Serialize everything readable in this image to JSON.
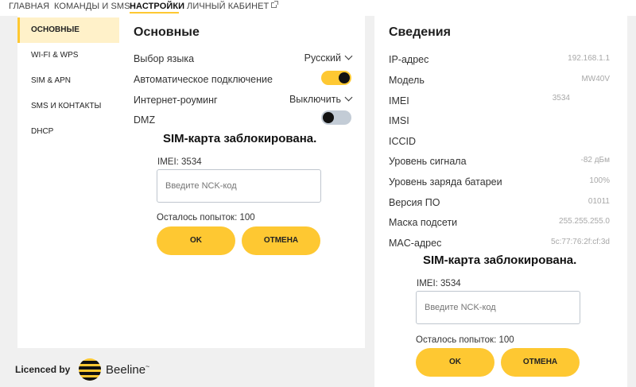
{
  "nav": {
    "items": [
      {
        "label": "ГЛАВНАЯ",
        "active": false
      },
      {
        "label": "КОМАНДЫ И SMS",
        "active": false
      },
      {
        "label": "НАСТРОЙКИ",
        "active": true
      },
      {
        "label": "ЛИЧНЫЙ КАБИНЕТ",
        "active": false,
        "icon": "external-link-icon"
      }
    ]
  },
  "sidebar": {
    "items": [
      {
        "label": "ОСНОВНЫЕ",
        "active": true
      },
      {
        "label": "WI-FI & WPS",
        "active": false
      },
      {
        "label": "SIM & APN",
        "active": false
      },
      {
        "label": "SMS И КОНТАКТЫ",
        "active": false
      },
      {
        "label": "DHCP",
        "active": false
      }
    ]
  },
  "basic": {
    "title": "Основные",
    "language_label": "Выбор языка",
    "language_value": "Русский",
    "autoconnect_label": "Автоматическое подключение",
    "autoconnect_on": true,
    "roaming_label": "Интернет-роуминг",
    "roaming_value": "Выключить",
    "dmz_label": "DMZ",
    "dmz_on": false
  },
  "sim_lock_left": {
    "title": "SIM-карта заблокирована.",
    "imei": "IMEI: 3534",
    "placeholder": "Введите NCK-код",
    "attempts": "Осталось попыток: 100",
    "ok_label": "OK",
    "cancel_label": "ОТМЕНА"
  },
  "info": {
    "title": "Сведения",
    "rows": [
      {
        "label": "IP-адрес",
        "value": "192.168.1.1"
      },
      {
        "label": "Модель",
        "value": "MW40V"
      },
      {
        "label": "IMEI",
        "value": "3534"
      },
      {
        "label": "IMSI",
        "value": ""
      },
      {
        "label": "ICCID",
        "value": ""
      },
      {
        "label": "Уровень сигнала",
        "value": "-82 дБм"
      },
      {
        "label": "Уровень заряда батареи",
        "value": "100%"
      },
      {
        "label": "Версия ПО",
        "value": "01011"
      },
      {
        "label": "Маска подсети",
        "value": "255.255.255.0"
      },
      {
        "label": "MAC-адрес",
        "value": "5c:77:76:2f:cf:3d"
      }
    ]
  },
  "sim_lock_right": {
    "title": "SIM-карта заблокирована.",
    "imei": "IMEI: 3534",
    "placeholder": "Введите NCK-код",
    "attempts": "Осталось попыток: 100",
    "ok_label": "OK",
    "cancel_label": "ОТМЕНА"
  },
  "footer": {
    "licenced_label": "Licenced by",
    "brand": "Beeline",
    "brand_mark": "~"
  },
  "colors": {
    "accent": "#fec832",
    "accent_light": "#fff1c9",
    "toggle_off": "#c3ccd6",
    "page_bg": "#f0f0f0"
  }
}
